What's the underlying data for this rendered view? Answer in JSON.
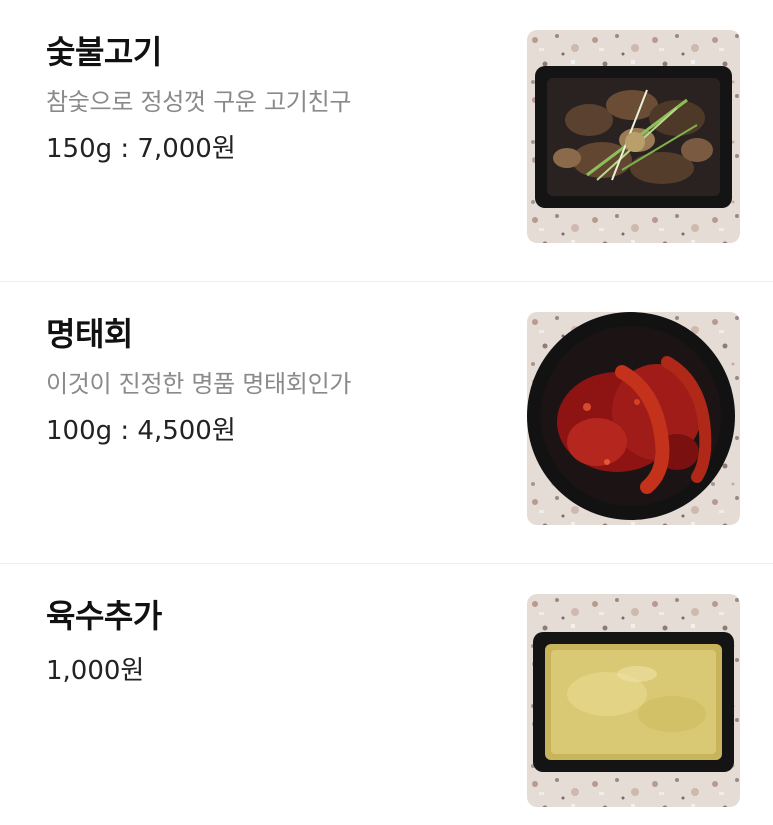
{
  "menu": {
    "items": [
      {
        "name": "숯불고기",
        "description": "참숯으로 정성껏 구운 고기친구",
        "price": "150g : 7,000원",
        "image_icon": "grilled-meat-photo"
      },
      {
        "name": "명태회",
        "description": "이것이 진정한 명품 명태회인가",
        "price": "100g : 4,500원",
        "image_icon": "spicy-pollock-photo"
      },
      {
        "name": "육수추가",
        "price": "1,000원",
        "image_icon": "broth-photo"
      }
    ]
  },
  "colors": {
    "name_text": "#111111",
    "description_text": "#8a8a8a",
    "price_text": "#222222",
    "divider": "#eeeeee",
    "terrazzo_base": "#e6dcd6"
  }
}
